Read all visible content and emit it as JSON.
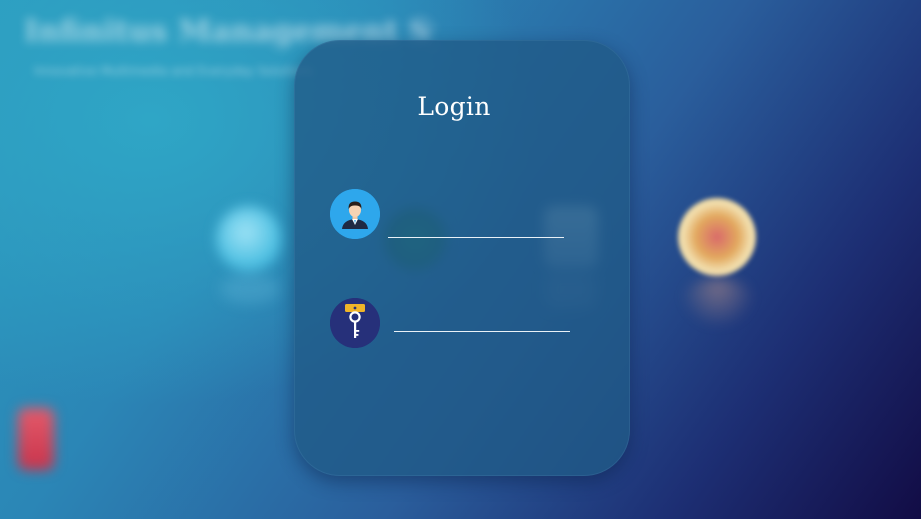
{
  "background": {
    "title": "Infinitus Management System",
    "subtitle": "Innovative Multimedia and Everyday Solutions",
    "apps": [
      {
        "icon": "browser-icon"
      },
      {
        "icon": "phone-icon"
      },
      {
        "icon": "document-icon"
      },
      {
        "icon": "badge-icon"
      },
      {
        "icon": "battery-icon"
      }
    ]
  },
  "login": {
    "title": "Login",
    "username": {
      "value": "",
      "placeholder": "",
      "icon": "user-avatar-icon"
    },
    "password": {
      "value": "",
      "placeholder": "",
      "icon": "key-icon"
    }
  },
  "colors": {
    "card": "#205a86",
    "user_icon_bg": "#2ea7ec",
    "key_icon_bg": "#26307a",
    "underline": "#e9f1f7"
  }
}
